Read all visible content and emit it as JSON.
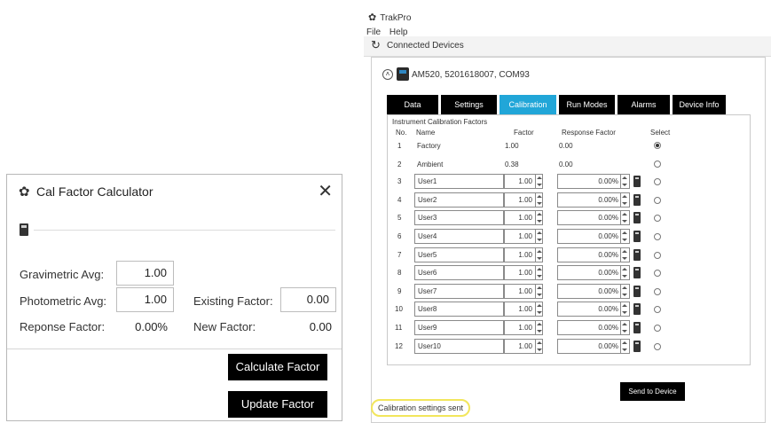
{
  "calc": {
    "title": "Cal Factor Calculator",
    "gravimetric_label": "Gravimetric Avg:",
    "gravimetric_value": "1.00",
    "photometric_label": "Photometric Avg:",
    "photometric_value": "1.00",
    "response_label": "Reponse Factor:",
    "response_value": "0.00%",
    "existing_label": "Existing Factor:",
    "existing_value": "0.00",
    "new_label": "New Factor:",
    "new_value": "0.00",
    "calculate_label": "Calculate Factor",
    "update_label": "Update Factor"
  },
  "trak": {
    "app_title": "TrakPro",
    "menu": [
      "File",
      "Help"
    ],
    "devices_title": "Connected Devices",
    "device_name": "AM520, 5201618007, COM93",
    "tabs": [
      "Data",
      "Settings",
      "Calibration",
      "Run Modes",
      "Alarms",
      "Device Info"
    ],
    "active_tab": "Calibration",
    "group_title": "Instrument Calibration Factors",
    "headers": {
      "no": "No.",
      "name": "Name",
      "factor": "Factor",
      "response": "Response Factor",
      "select": "Select"
    },
    "rows": [
      {
        "no": "1",
        "name": "Factory",
        "factor": "1.00",
        "response": "0.00",
        "editable": false,
        "selected": true
      },
      {
        "no": "2",
        "name": "Ambient",
        "factor": "0.38",
        "response": "0.00",
        "editable": false,
        "selected": false
      },
      {
        "no": "3",
        "name": "User1",
        "factor": "1.00",
        "response": "0.00%",
        "editable": true,
        "selected": false
      },
      {
        "no": "4",
        "name": "User2",
        "factor": "1.00",
        "response": "0.00%",
        "editable": true,
        "selected": false
      },
      {
        "no": "5",
        "name": "User3",
        "factor": "1.00",
        "response": "0.00%",
        "editable": true,
        "selected": false
      },
      {
        "no": "6",
        "name": "User4",
        "factor": "1.00",
        "response": "0.00%",
        "editable": true,
        "selected": false
      },
      {
        "no": "7",
        "name": "User5",
        "factor": "1.00",
        "response": "0.00%",
        "editable": true,
        "selected": false
      },
      {
        "no": "8",
        "name": "User6",
        "factor": "1.00",
        "response": "0.00%",
        "editable": true,
        "selected": false
      },
      {
        "no": "9",
        "name": "User7",
        "factor": "1.00",
        "response": "0.00%",
        "editable": true,
        "selected": false
      },
      {
        "no": "10",
        "name": "User8",
        "factor": "1.00",
        "response": "0.00%",
        "editable": true,
        "selected": false
      },
      {
        "no": "11",
        "name": "User9",
        "factor": "1.00",
        "response": "0.00%",
        "editable": true,
        "selected": false
      },
      {
        "no": "12",
        "name": "User10",
        "factor": "1.00",
        "response": "0.00%",
        "editable": true,
        "selected": false
      }
    ],
    "send_label": "Send to Device",
    "status_text": "Calibration settings sent"
  }
}
